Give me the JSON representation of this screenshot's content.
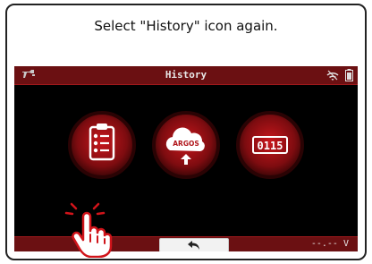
{
  "instruction": "Select \"History\" icon again.",
  "screen": {
    "title": "History",
    "icons": [
      {
        "name": "checklist-icon"
      },
      {
        "name": "argos-cloud-icon",
        "label": "ARGOS"
      },
      {
        "name": "counter-icon",
        "label": "0115"
      }
    ],
    "voltage": "--.-- V"
  },
  "colors": {
    "bar": "#6b1012",
    "accent_red": "#d0141a",
    "background": "#000000"
  }
}
